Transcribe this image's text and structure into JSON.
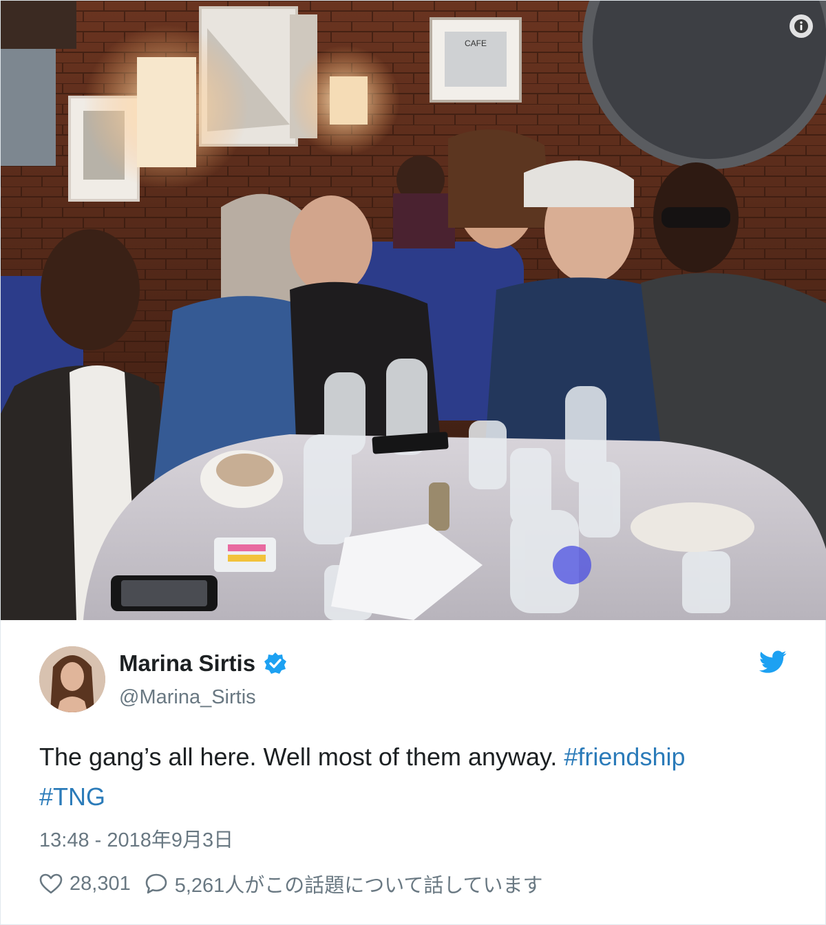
{
  "tweet": {
    "author": {
      "display_name": "Marina Sirtis",
      "handle": "@Marina_Sirtis",
      "verified": true
    },
    "text_parts": {
      "main": "The gang’s all here. Well most of them anyway. ",
      "hashtag_1": "#friendship",
      "hashtag_2": "#TNG"
    },
    "timestamp": "13:48 - 2018年9月3日",
    "likes": "28,301",
    "replies_text": "5,261人がこの話題について話しています"
  },
  "photo": {
    "sign_text": "CAFE",
    "description_icon": "info-icon"
  },
  "icons": {
    "info": "info-icon",
    "verified": "verified-badge-icon",
    "brand": "twitter-bird-icon",
    "like": "heart-icon",
    "reply": "speech-bubble-icon"
  },
  "colors": {
    "link": "#2b7bb9",
    "verified": "#1da1f2",
    "muted": "#697882",
    "text": "#1c2022"
  }
}
